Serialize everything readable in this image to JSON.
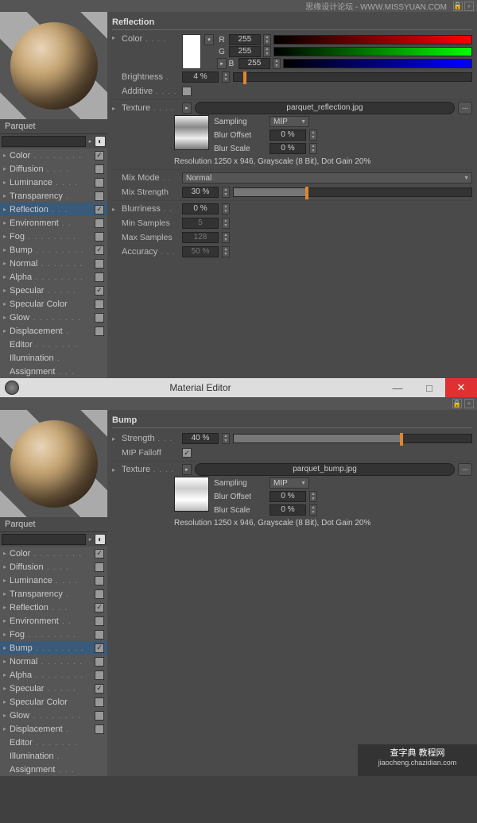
{
  "watermarks": {
    "top": "思缘设计论坛 - WWW.MISSYUAN.COM",
    "bottom_title": "查字典 教程网",
    "bottom_sub": "jiaocheng.chazidian.com"
  },
  "window_title": "Material Editor",
  "material_name": "Parquet",
  "channels": [
    {
      "name": "Color",
      "checked": true,
      "expandable": true
    },
    {
      "name": "Diffusion",
      "checked": false,
      "expandable": true
    },
    {
      "name": "Luminance",
      "checked": false,
      "expandable": true
    },
    {
      "name": "Transparency",
      "checked": false,
      "expandable": true
    },
    {
      "name": "Reflection",
      "checked": true,
      "expandable": true
    },
    {
      "name": "Environment",
      "checked": false,
      "expandable": true
    },
    {
      "name": "Fog",
      "checked": false,
      "expandable": true
    },
    {
      "name": "Bump",
      "checked": true,
      "expandable": true
    },
    {
      "name": "Normal",
      "checked": false,
      "expandable": true
    },
    {
      "name": "Alpha",
      "checked": false,
      "expandable": true
    },
    {
      "name": "Specular",
      "checked": true,
      "expandable": true
    },
    {
      "name": "Specular Color",
      "checked": false,
      "expandable": true
    },
    {
      "name": "Glow",
      "checked": false,
      "expandable": true
    },
    {
      "name": "Displacement",
      "checked": false,
      "expandable": true
    },
    {
      "name": "Editor",
      "checked": null,
      "expandable": false
    },
    {
      "name": "Illumination",
      "checked": null,
      "expandable": false
    },
    {
      "name": "Assignment",
      "checked": null,
      "expandable": false
    }
  ],
  "reflection": {
    "title": "Reflection",
    "color_label": "Color",
    "rgb": {
      "R": "255",
      "G": "255",
      "B": "255"
    },
    "brightness_label": "Brightness",
    "brightness_value": "4 %",
    "additive_label": "Additive",
    "additive_checked": false,
    "texture_label": "Texture",
    "texture_file": "parquet_reflection.jpg",
    "sampling_label": "Sampling",
    "sampling_value": "MIP",
    "blur_offset_label": "Blur Offset",
    "blur_offset_value": "0 %",
    "blur_scale_label": "Blur Scale",
    "blur_scale_value": "0 %",
    "resolution_text": "Resolution 1250 x 946, Grayscale (8 Bit), Dot Gain 20%",
    "mix_mode_label": "Mix Mode",
    "mix_mode_value": "Normal",
    "mix_strength_label": "Mix Strength",
    "mix_strength_value": "30 %",
    "blurriness_label": "Blurriness",
    "blurriness_value": "0 %",
    "min_samples_label": "Min Samples",
    "min_samples_value": "5",
    "max_samples_label": "Max Samples",
    "max_samples_value": "128",
    "accuracy_label": "Accuracy",
    "accuracy_value": "50 %"
  },
  "bump": {
    "title": "Bump",
    "strength_label": "Strength",
    "strength_value": "40 %",
    "mip_falloff_label": "MIP Falloff",
    "mip_falloff_checked": true,
    "texture_label": "Texture",
    "texture_file": "parquet_bump.jpg",
    "sampling_label": "Sampling",
    "sampling_value": "MIP",
    "blur_offset_label": "Blur Offset",
    "blur_offset_value": "0 %",
    "blur_scale_label": "Blur Scale",
    "blur_scale_value": "0 %",
    "resolution_text": "Resolution 1250 x 946, Grayscale (8 Bit), Dot Gain 20%"
  }
}
